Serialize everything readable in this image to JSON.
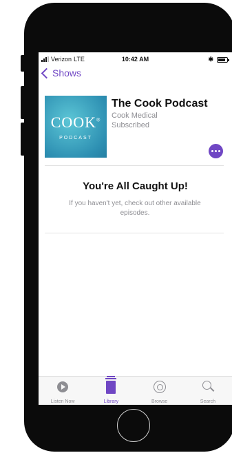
{
  "status_bar": {
    "carrier": "Verizon",
    "network": "LTE",
    "time": "10:42 AM"
  },
  "nav": {
    "back_label": "Shows"
  },
  "podcast": {
    "artwork_word": "COOK",
    "artwork_mark": "®",
    "artwork_subtitle": "PODCAST",
    "title": "The Cook Podcast",
    "author": "Cook Medical",
    "status": "Subscribed"
  },
  "empty_state": {
    "title": "You're All Caught Up!",
    "message": "If you haven't yet, check out other available episodes."
  },
  "tabs": [
    {
      "label": "Listen Now",
      "icon": "play-circle-icon",
      "active": false
    },
    {
      "label": "Library",
      "icon": "library-icon",
      "active": true
    },
    {
      "label": "Browse",
      "icon": "podcast-icon",
      "active": false
    },
    {
      "label": "Search",
      "icon": "search-icon",
      "active": false
    }
  ],
  "colors": {
    "accent": "#7047c4",
    "artwork_blue": "#2d8fb2",
    "secondary_text": "#8e8e93",
    "phone_body": "#0b0b0b"
  }
}
